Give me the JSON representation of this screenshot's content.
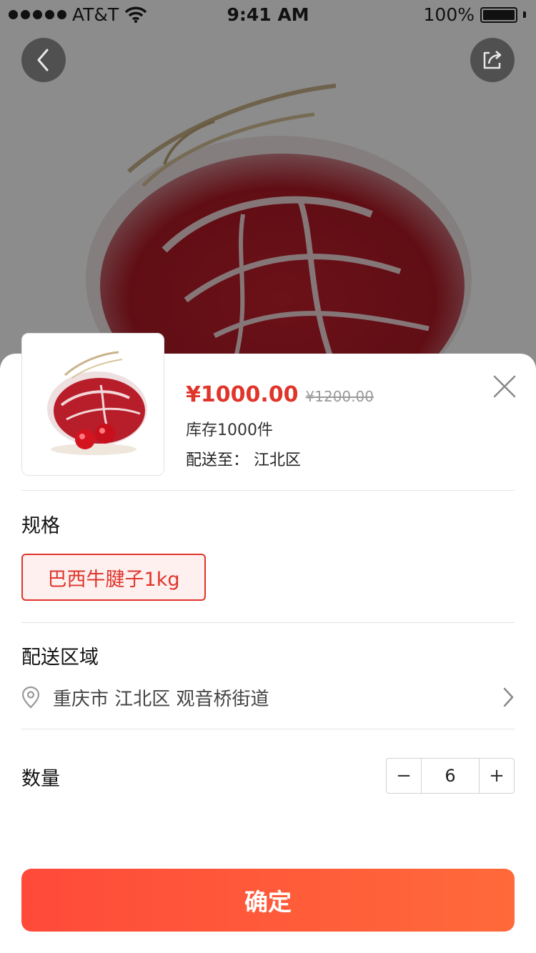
{
  "status_bar": {
    "carrier": "AT&T",
    "time": "9:41 AM",
    "battery": "100%"
  },
  "nav": {
    "back_icon": "chevron-left-icon",
    "share_icon": "share-icon"
  },
  "product": {
    "price": "¥1000.00",
    "original_price": "¥1200.00",
    "stock": "库存1000件",
    "ship_to_label": "配送至：",
    "ship_to_value": "江北区"
  },
  "spec": {
    "title": "规格",
    "selected_option": "巴西牛腱子1kg"
  },
  "delivery": {
    "title": "配送区域",
    "address": "重庆市 江北区 观音桥街道"
  },
  "quantity": {
    "title": "数量",
    "value": "6",
    "minus": "−",
    "plus": "+"
  },
  "actions": {
    "confirm_label": "确定"
  },
  "colors": {
    "accent": "#e0352b",
    "button_gradient_start": "#ff4a3a",
    "button_gradient_end": "#ff6a3a"
  }
}
